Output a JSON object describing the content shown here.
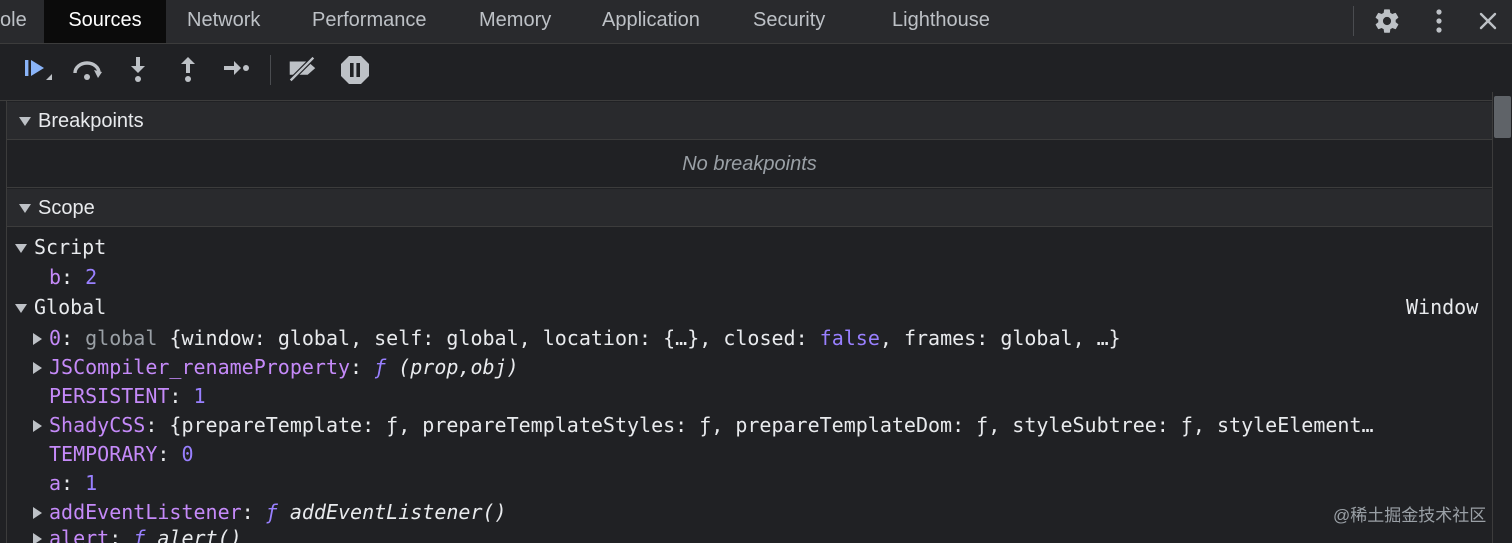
{
  "tabs": [
    {
      "label": "ole"
    },
    {
      "label": "Sources"
    },
    {
      "label": "Network"
    },
    {
      "label": "Performance"
    },
    {
      "label": "Memory"
    },
    {
      "label": "Application"
    },
    {
      "label": "Security"
    },
    {
      "label": "Lighthouse"
    }
  ],
  "toolbar_icons": [
    "resume-icon",
    "step-over-icon",
    "step-into-icon",
    "step-out-icon",
    "step-icon",
    "deactivate-breakpoints-icon",
    "pause-on-exceptions-icon"
  ],
  "breakpoints": {
    "title": "Breakpoints",
    "empty": "No breakpoints"
  },
  "scope": {
    "title": "Scope",
    "script": {
      "label": "Script",
      "b_key": "b",
      "b_val": "2"
    },
    "global": {
      "label": "Global",
      "type": "Window",
      "rows": {
        "r0": {
          "key": "0",
          "pre": "global",
          "t1": "{window: ",
          "v1": "global",
          "t2": ", self: ",
          "v2": "global",
          "t3": ", location: {…}, closed: ",
          "v3": "false",
          "t4": ", frames: ",
          "v4": "global",
          "t5": ", …}"
        },
        "r1": {
          "key": "JSCompiler_renameProperty",
          "fn": "ƒ",
          "sig": "(prop,obj)"
        },
        "r2": {
          "key": "PERSISTENT",
          "val": "1"
        },
        "r3": {
          "key": "ShadyCSS",
          "text": "{prepareTemplate: ƒ, prepareTemplateStyles: ƒ, prepareTemplateDom: ƒ, styleSubtree: ƒ, styleElement…"
        },
        "r4": {
          "key": "TEMPORARY",
          "val": "0"
        },
        "r5": {
          "key": "a",
          "val": "1"
        },
        "r6": {
          "key": "addEventListener",
          "fn": "ƒ",
          "sig": "addEventListener()"
        },
        "r7": {
          "key": "alert",
          "fn": "ƒ",
          "sig": "alert()"
        }
      }
    }
  },
  "watermark": "@稀土掘金技术社区",
  "colors": {
    "accent": "#8ab4f8",
    "key": "#c58af9",
    "number": "#9980ff",
    "bg": "#202124"
  }
}
